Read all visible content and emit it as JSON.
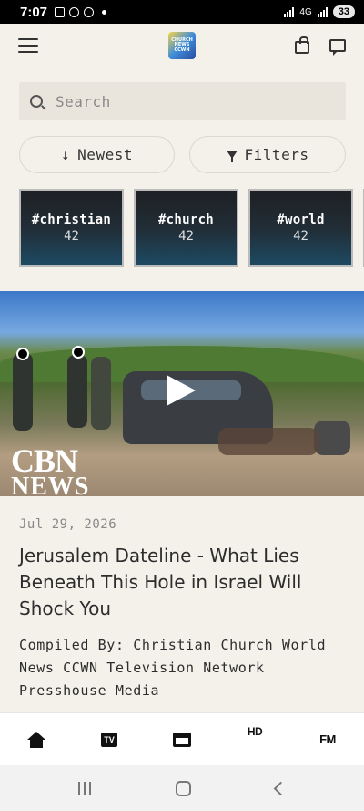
{
  "status_bar": {
    "time": "7:07",
    "network": "4G",
    "battery": "33"
  },
  "header": {
    "logo_text": "CHURCH NEWS CCWN"
  },
  "search": {
    "placeholder": "Search"
  },
  "sort": {
    "label": "Newest"
  },
  "filters": {
    "label": "Filters"
  },
  "tags": [
    {
      "name": "#christian",
      "count": "42"
    },
    {
      "name": "#church",
      "count": "42"
    },
    {
      "name": "#world",
      "count": "42"
    }
  ],
  "video": {
    "watermark_line1": "CBN",
    "watermark_line2": "NEWS"
  },
  "article": {
    "date": "Jul 29, 2026",
    "title": "Jerusalem Dateline - What Lies Beneath This Hole in Israel Will Shock You",
    "byline": "Compiled By: Christian Church World News CCWN Television Network Presshouse Media"
  },
  "bottom_nav": {
    "tv": "TV",
    "hd": "HD",
    "fm": "FM"
  },
  "colors": {
    "background": "#f4f1ea",
    "tile_dark": "#1e2024",
    "tile_blue": "#1d4a63"
  }
}
